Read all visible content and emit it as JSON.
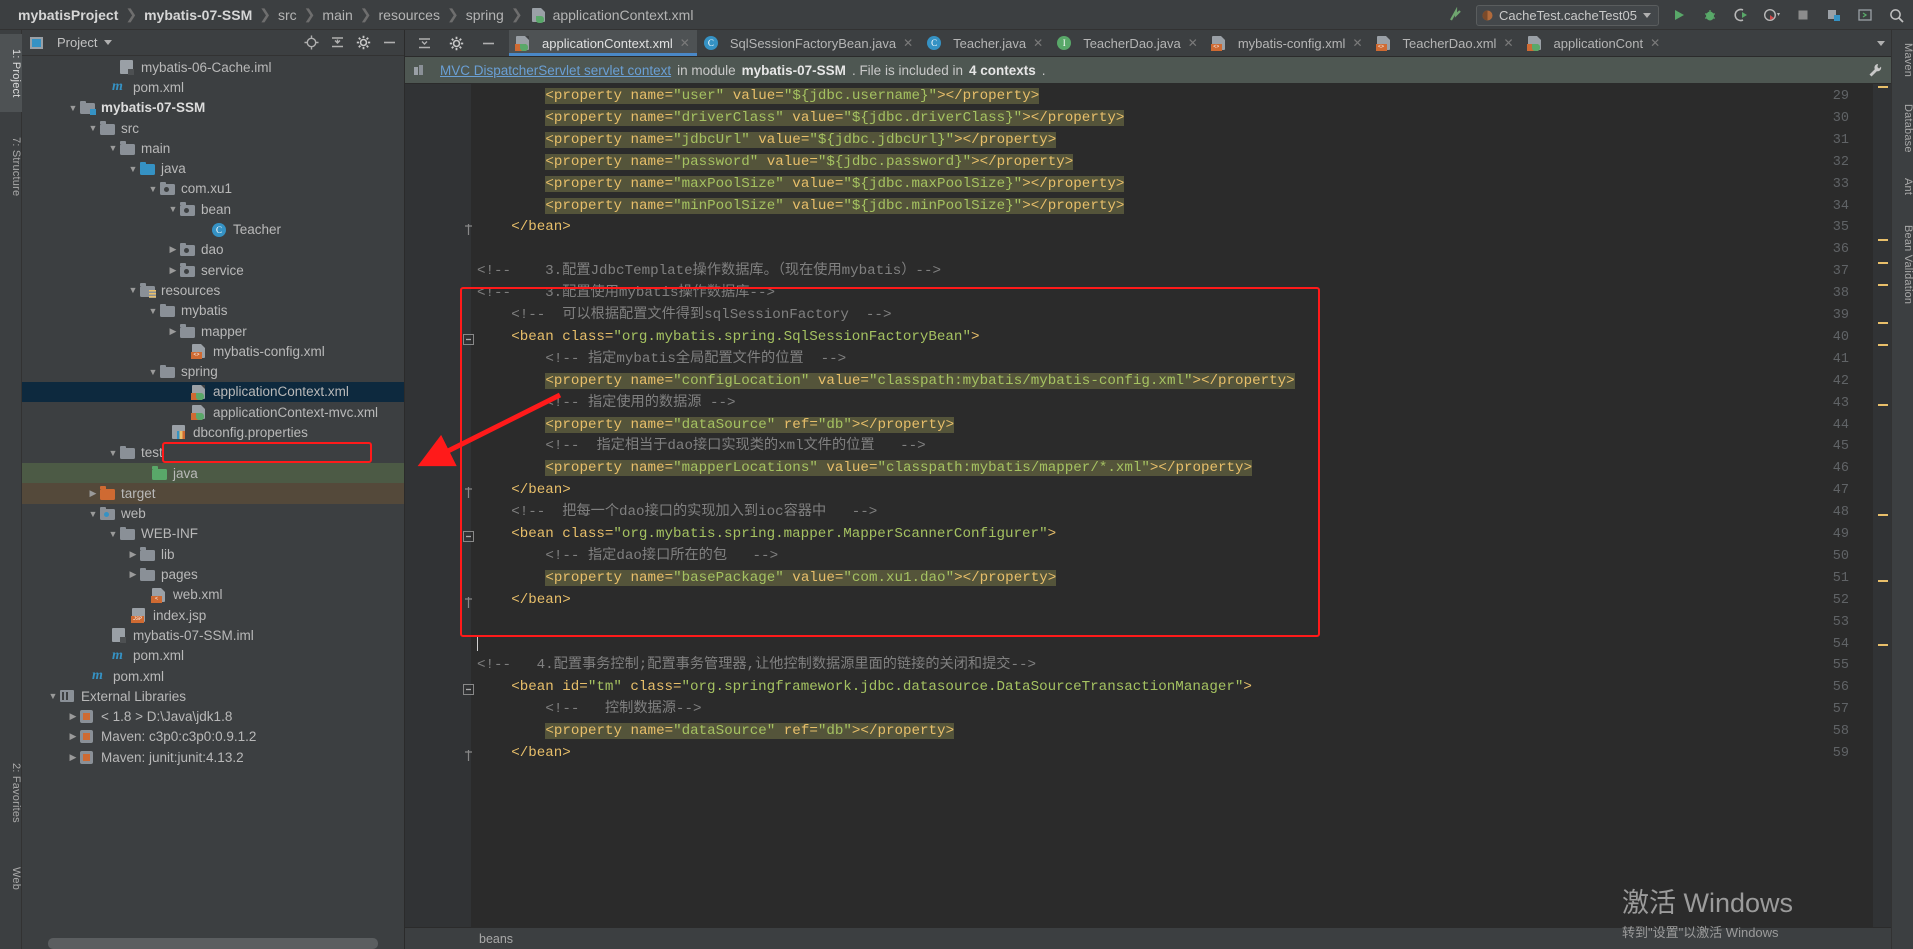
{
  "navbar": {
    "breadcrumbs": [
      "mybatisProject",
      "mybatis-07-SSM",
      "src",
      "main",
      "resources",
      "spring",
      "applicationContext.xml"
    ],
    "run_config": "CacheTest.cacheTest05",
    "icons": [
      "update-project-icon",
      "run-icon",
      "debug-icon",
      "run-with-coverage-icon",
      "profile-icon",
      "stop-icon",
      "build-icon",
      "terminal-icon",
      "search-everywhere-icon"
    ]
  },
  "left_strip": {
    "tabs": [
      "1: Project",
      "7: Structure",
      "2: Favorites",
      "Web"
    ]
  },
  "right_strip": {
    "tabs": [
      "Maven",
      "Database",
      "Ant",
      "Bean Validation"
    ]
  },
  "project_panel": {
    "title": "Project",
    "header_icons": [
      "locate-icon",
      "collapse-all-icon",
      "settings-icon",
      "hide-icon"
    ],
    "tree": [
      {
        "label": "mybatis-06-Cache.iml",
        "indent": 4,
        "arrow": "none",
        "icon": "iml-file-icon"
      },
      {
        "label": "pom.xml",
        "indent": 3.6,
        "arrow": "none",
        "icon": "maven-pom-icon"
      },
      {
        "label": "mybatis-07-SSM",
        "indent": 2,
        "arrow": "open",
        "icon": "module-folder-icon",
        "bold": true
      },
      {
        "label": "src",
        "indent": 3,
        "arrow": "open",
        "icon": "folder-icon"
      },
      {
        "label": "main",
        "indent": 4,
        "arrow": "open",
        "icon": "folder-icon"
      },
      {
        "label": "java",
        "indent": 5,
        "arrow": "open",
        "icon": "source-folder-icon"
      },
      {
        "label": "com.xu1",
        "indent": 6,
        "arrow": "open",
        "icon": "package-icon"
      },
      {
        "label": "bean",
        "indent": 7,
        "arrow": "open",
        "icon": "package-icon"
      },
      {
        "label": "Teacher",
        "indent": 8.6,
        "arrow": "none",
        "icon": "java-class-icon"
      },
      {
        "label": "dao",
        "indent": 7,
        "arrow": "closed",
        "icon": "package-icon"
      },
      {
        "label": "service",
        "indent": 7,
        "arrow": "closed",
        "icon": "package-icon"
      },
      {
        "label": "resources",
        "indent": 5,
        "arrow": "open",
        "icon": "resources-folder-icon"
      },
      {
        "label": "mybatis",
        "indent": 6,
        "arrow": "open",
        "icon": "folder-icon"
      },
      {
        "label": "mapper",
        "indent": 7,
        "arrow": "closed",
        "icon": "folder-icon"
      },
      {
        "label": "mybatis-config.xml",
        "indent": 7.6,
        "arrow": "none",
        "icon": "xml-file-icon"
      },
      {
        "label": "spring",
        "indent": 6,
        "arrow": "open",
        "icon": "folder-icon"
      },
      {
        "label": "applicationContext.xml",
        "indent": 7.6,
        "arrow": "none",
        "icon": "spring-xml-icon",
        "selected": true,
        "highlighted": true
      },
      {
        "label": "applicationContext-mvc.xml",
        "indent": 7.6,
        "arrow": "none",
        "icon": "spring-xml-icon"
      },
      {
        "label": "dbconfig.properties",
        "indent": 6.6,
        "arrow": "none",
        "icon": "properties-file-icon"
      },
      {
        "label": "test",
        "indent": 4,
        "arrow": "open",
        "icon": "folder-icon"
      },
      {
        "label": "java",
        "indent": 5.6,
        "arrow": "none",
        "icon": "test-source-folder-icon",
        "rowcolor": "green"
      },
      {
        "label": "target",
        "indent": 3,
        "arrow": "closed",
        "icon": "excluded-folder-icon",
        "rowcolor": "brown"
      },
      {
        "label": "web",
        "indent": 3,
        "arrow": "open",
        "icon": "web-folder-icon"
      },
      {
        "label": "WEB-INF",
        "indent": 4,
        "arrow": "open",
        "icon": "folder-icon"
      },
      {
        "label": "lib",
        "indent": 5,
        "arrow": "closed",
        "icon": "folder-icon"
      },
      {
        "label": "pages",
        "indent": 5,
        "arrow": "closed",
        "icon": "folder-icon"
      },
      {
        "label": "web.xml",
        "indent": 5.6,
        "arrow": "none",
        "icon": "web-xml-icon"
      },
      {
        "label": "index.jsp",
        "indent": 4.6,
        "arrow": "none",
        "icon": "jsp-file-icon"
      },
      {
        "label": "mybatis-07-SSM.iml",
        "indent": 3.6,
        "arrow": "none",
        "icon": "iml-file-icon"
      },
      {
        "label": "pom.xml",
        "indent": 3.6,
        "arrow": "none",
        "icon": "maven-pom-icon"
      },
      {
        "label": "pom.xml",
        "indent": 2.6,
        "arrow": "none",
        "icon": "maven-pom-icon"
      },
      {
        "label": "External Libraries",
        "indent": 1,
        "arrow": "open",
        "icon": "library-icon"
      },
      {
        "label": "< 1.8 >  D:\\Java\\jdk1.8",
        "indent": 2,
        "arrow": "closed",
        "icon": "sdk-icon"
      },
      {
        "label": "Maven: c3p0:c3p0:0.9.1.2",
        "indent": 2,
        "arrow": "closed",
        "icon": "maven-lib-icon"
      },
      {
        "label": "Maven: junit:junit:4.13.2",
        "indent": 2,
        "arrow": "closed",
        "icon": "maven-lib-icon"
      }
    ]
  },
  "editor": {
    "tabs": [
      {
        "label": "applicationContext.xml",
        "icon": "spring-xml-icon",
        "active": true
      },
      {
        "label": "SqlSessionFactoryBean.java",
        "icon": "java-class-icon",
        "active": false
      },
      {
        "label": "Teacher.java",
        "icon": "java-class-icon",
        "active": false
      },
      {
        "label": "TeacherDao.java",
        "icon": "java-interface-icon",
        "active": false
      },
      {
        "label": "mybatis-config.xml",
        "icon": "xml-file-icon",
        "active": false
      },
      {
        "label": "TeacherDao.xml",
        "icon": "xml-file-icon",
        "active": false
      },
      {
        "label": "applicationCont",
        "icon": "spring-xml-icon",
        "active": false
      }
    ],
    "notification": {
      "link": "MVC DispatcherServlet servlet context",
      "text_before_module": "in module",
      "module": "mybatis-07-SSM",
      "text_after": ". File is included in",
      "contexts": "4 contexts",
      "period": ".",
      "wrench_icon": "configure-icon"
    },
    "first_line_number": 29,
    "lines": [
      {
        "n": 29,
        "indent": 8,
        "segments": [
          {
            "t": "<property ",
            "c": "tagc"
          },
          {
            "t": "name=",
            "c": "attrn"
          },
          {
            "t": "\"user\"",
            "c": "val"
          },
          {
            "t": " value=",
            "c": "attrn"
          },
          {
            "t": "\"${jdbc.username}\"",
            "c": "val"
          },
          {
            "t": "></property>",
            "c": "tagc"
          }
        ],
        "hl": true
      },
      {
        "n": 30,
        "indent": 8,
        "segments": [
          {
            "t": "<property ",
            "c": "tagc"
          },
          {
            "t": "name=",
            "c": "attrn"
          },
          {
            "t": "\"driverClass\"",
            "c": "val"
          },
          {
            "t": " value=",
            "c": "attrn"
          },
          {
            "t": "\"${jdbc.driverClass}\"",
            "c": "val"
          },
          {
            "t": "></property>",
            "c": "tagc"
          }
        ],
        "hl": true
      },
      {
        "n": 31,
        "indent": 8,
        "segments": [
          {
            "t": "<property ",
            "c": "tagc"
          },
          {
            "t": "name=",
            "c": "attrn"
          },
          {
            "t": "\"jdbcUrl\"",
            "c": "val"
          },
          {
            "t": " value=",
            "c": "attrn"
          },
          {
            "t": "\"${jdbc.jdbcUrl}\"",
            "c": "val"
          },
          {
            "t": "></property>",
            "c": "tagc"
          }
        ],
        "hl": true
      },
      {
        "n": 32,
        "indent": 8,
        "segments": [
          {
            "t": "<property ",
            "c": "tagc"
          },
          {
            "t": "name=",
            "c": "attrn"
          },
          {
            "t": "\"password\"",
            "c": "val"
          },
          {
            "t": " value=",
            "c": "attrn"
          },
          {
            "t": "\"${jdbc.password}\"",
            "c": "val"
          },
          {
            "t": "></property>",
            "c": "tagc"
          }
        ],
        "hl": true
      },
      {
        "n": 33,
        "indent": 8,
        "segments": [
          {
            "t": "<property ",
            "c": "tagc"
          },
          {
            "t": "name=",
            "c": "attrn"
          },
          {
            "t": "\"maxPoolSize\"",
            "c": "val"
          },
          {
            "t": " value=",
            "c": "attrn"
          },
          {
            "t": "\"${jdbc.maxPoolSize}\"",
            "c": "val"
          },
          {
            "t": "></property>",
            "c": "tagc"
          }
        ],
        "hl": true
      },
      {
        "n": 34,
        "indent": 8,
        "segments": [
          {
            "t": "<property ",
            "c": "tagc"
          },
          {
            "t": "name=",
            "c": "attrn"
          },
          {
            "t": "\"minPoolSize\"",
            "c": "val"
          },
          {
            "t": " value=",
            "c": "attrn"
          },
          {
            "t": "\"${jdbc.minPoolSize}\"",
            "c": "val"
          },
          {
            "t": "></property>",
            "c": "tagc"
          }
        ],
        "hl": true
      },
      {
        "n": 35,
        "indent": 4,
        "segments": [
          {
            "t": "</bean>",
            "c": "tagc"
          }
        ]
      },
      {
        "n": 36,
        "indent": 0,
        "segments": []
      },
      {
        "n": 37,
        "indent": 0,
        "segments": [
          {
            "t": "<!--    3.配置JdbcTemplate操作数据库。（现在使用mybatis）-->",
            "c": "cmt"
          }
        ]
      },
      {
        "n": 38,
        "indent": 0,
        "segments": [
          {
            "t": "<!--    3.配置使用mybatis操作数据库-->",
            "c": "cmt"
          }
        ]
      },
      {
        "n": 39,
        "indent": 4,
        "segments": [
          {
            "t": "<!--  可以根据配置文件得到sqlSessionFactory  -->",
            "c": "cmt"
          }
        ]
      },
      {
        "n": 40,
        "indent": 4,
        "segments": [
          {
            "t": "<bean ",
            "c": "tagc"
          },
          {
            "t": "class=",
            "c": "attrn"
          },
          {
            "t": "\"org.mybatis.spring.SqlSessionFactoryBean\"",
            "c": "val"
          },
          {
            "t": ">",
            "c": "tagc"
          }
        ]
      },
      {
        "n": 41,
        "indent": 8,
        "segments": [
          {
            "t": "<!-- 指定mybatis全局配置文件的位置  -->",
            "c": "cmt"
          }
        ]
      },
      {
        "n": 42,
        "indent": 8,
        "segments": [
          {
            "t": "<property ",
            "c": "tagc"
          },
          {
            "t": "name=",
            "c": "attrn"
          },
          {
            "t": "\"configLocation\"",
            "c": "val"
          },
          {
            "t": " value=",
            "c": "attrn"
          },
          {
            "t": "\"classpath:mybatis/mybatis-config.xml\"",
            "c": "val"
          },
          {
            "t": "></property>",
            "c": "tagc"
          }
        ],
        "hl": true
      },
      {
        "n": 43,
        "indent": 8,
        "segments": [
          {
            "t": "<!-- 指定使用的数据源 -->",
            "c": "cmt"
          }
        ]
      },
      {
        "n": 44,
        "indent": 8,
        "segments": [
          {
            "t": "<property ",
            "c": "tagc"
          },
          {
            "t": "name=",
            "c": "attrn"
          },
          {
            "t": "\"dataSource\"",
            "c": "val"
          },
          {
            "t": " ref=",
            "c": "attrn"
          },
          {
            "t": "\"db\"",
            "c": "val"
          },
          {
            "t": "></property>",
            "c": "tagc"
          }
        ],
        "hl": true
      },
      {
        "n": 45,
        "indent": 8,
        "segments": [
          {
            "t": "<!--  指定相当于dao接口实现类的xml文件的位置   -->",
            "c": "cmt"
          }
        ]
      },
      {
        "n": 46,
        "indent": 8,
        "segments": [
          {
            "t": "<property ",
            "c": "tagc"
          },
          {
            "t": "name=",
            "c": "attrn"
          },
          {
            "t": "\"mapperLocations\"",
            "c": "val"
          },
          {
            "t": " value=",
            "c": "attrn"
          },
          {
            "t": "\"classpath:mybatis/mapper/*.xml\"",
            "c": "val"
          },
          {
            "t": "></property>",
            "c": "tagc"
          }
        ],
        "hl": true
      },
      {
        "n": 47,
        "indent": 4,
        "segments": [
          {
            "t": "</bean>",
            "c": "tagc"
          }
        ]
      },
      {
        "n": 48,
        "indent": 4,
        "segments": [
          {
            "t": "<!--  把每一个dao接口的实现加入到ioc容器中   -->",
            "c": "cmt"
          }
        ]
      },
      {
        "n": 49,
        "indent": 4,
        "segments": [
          {
            "t": "<bean ",
            "c": "tagc"
          },
          {
            "t": "class=",
            "c": "attrn"
          },
          {
            "t": "\"org.mybatis.spring.mapper.MapperScannerConfigurer\"",
            "c": "val"
          },
          {
            "t": ">",
            "c": "tagc"
          }
        ]
      },
      {
        "n": 50,
        "indent": 8,
        "segments": [
          {
            "t": "<!-- 指定dao接口所在的包   -->",
            "c": "cmt"
          }
        ]
      },
      {
        "n": 51,
        "indent": 8,
        "segments": [
          {
            "t": "<property ",
            "c": "tagc"
          },
          {
            "t": "name=",
            "c": "attrn"
          },
          {
            "t": "\"basePackage\"",
            "c": "val"
          },
          {
            "t": " value=",
            "c": "attrn"
          },
          {
            "t": "\"com.xu1.dao\"",
            "c": "val"
          },
          {
            "t": "></property>",
            "c": "tagc"
          }
        ],
        "hl": true
      },
      {
        "n": 52,
        "indent": 4,
        "segments": [
          {
            "t": "</bean>",
            "c": "tagc"
          }
        ]
      },
      {
        "n": 53,
        "indent": 0,
        "segments": []
      },
      {
        "n": 54,
        "indent": 0,
        "segments": [],
        "caret": true
      },
      {
        "n": 55,
        "indent": 0,
        "segments": [
          {
            "t": "<!--   4.配置事务控制;配置事务管理器,让他控制数据源里面的链接的关闭和提交-->",
            "c": "cmt"
          }
        ]
      },
      {
        "n": 56,
        "indent": 4,
        "segments": [
          {
            "t": "<bean ",
            "c": "tagc"
          },
          {
            "t": "id=",
            "c": "attrn"
          },
          {
            "t": "\"tm\"",
            "c": "val"
          },
          {
            "t": " class=",
            "c": "attrn"
          },
          {
            "t": "\"org.springframework.jdbc.datasource.DataSourceTransactionManager\"",
            "c": "val"
          },
          {
            "t": ">",
            "c": "tagc"
          }
        ]
      },
      {
        "n": 57,
        "indent": 8,
        "segments": [
          {
            "t": "<!--   控制数据源-->",
            "c": "cmt"
          }
        ]
      },
      {
        "n": 58,
        "indent": 8,
        "segments": [
          {
            "t": "<property ",
            "c": "tagc"
          },
          {
            "t": "name=",
            "c": "attrn"
          },
          {
            "t": "\"dataSource\"",
            "c": "val"
          },
          {
            "t": " ref=",
            "c": "attrn"
          },
          {
            "t": "\"db\"",
            "c": "val"
          },
          {
            "t": "></property>",
            "c": "tagc"
          }
        ],
        "hl": true
      },
      {
        "n": 59,
        "indent": 4,
        "segments": [
          {
            "t": "</bean>",
            "c": "tagc"
          }
        ]
      }
    ],
    "status_breadcrumb": "beans"
  },
  "watermark": {
    "line1": "激活 Windows",
    "line2": "转到\"设置\"以激活 Windows"
  },
  "colors": {
    "annotation_red": "#ff1a1a",
    "tab_underline": "#4a88c7",
    "selection_blue": "#0d293e",
    "editor_bg": "#2b2b2b",
    "panel_bg": "#3c3f41"
  }
}
